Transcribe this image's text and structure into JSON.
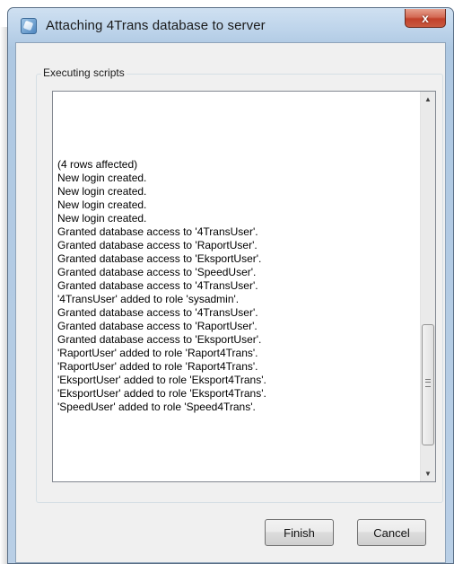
{
  "window": {
    "title": "Attaching 4Trans database to server",
    "close_label": "x"
  },
  "group": {
    "label": "Executing scripts"
  },
  "log": {
    "lines": [
      "(4 rows affected)",
      "New login created.",
      "New login created.",
      "New login created.",
      "New login created.",
      "Granted database access to '4TransUser'.",
      "Granted database access to 'RaportUser'.",
      "Granted database access to 'EksportUser'.",
      "Granted database access to 'SpeedUser'.",
      "Granted database access to '4TransUser'.",
      "'4TransUser' added to role 'sysadmin'.",
      "Granted database access to '4TransUser'.",
      "Granted database access to 'RaportUser'.",
      "Granted database access to 'EksportUser'.",
      "'RaportUser' added to role 'Raport4Trans'.",
      "'RaportUser' added to role 'Raport4Trans'.",
      "'EksportUser' added to role 'Eksport4Trans'.",
      "'EksportUser' added to role 'Eksport4Trans'.",
      "'SpeedUser' added to role 'Speed4Trans'."
    ]
  },
  "buttons": {
    "finish": "Finish",
    "cancel": "Cancel"
  },
  "icons": {
    "scroll_up": "up-arrow",
    "scroll_down": "down-arrow"
  }
}
